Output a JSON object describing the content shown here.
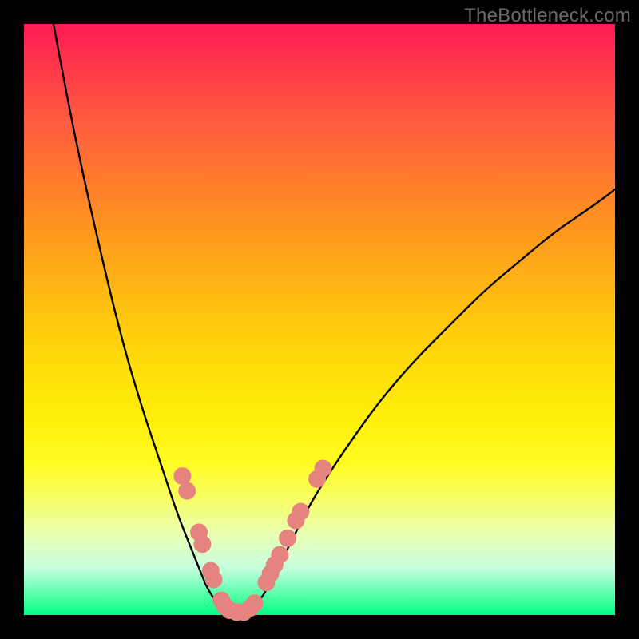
{
  "watermark": "TheBottleneck.com",
  "colors": {
    "frame": "#000000",
    "curve": "#000000",
    "marker_fill": "#e5847f",
    "marker_stroke": "#d46f6a"
  },
  "chart_data": {
    "type": "line",
    "title": "",
    "xlabel": "",
    "ylabel": "",
    "xlim": [
      0,
      100
    ],
    "ylim": [
      0,
      100
    ],
    "series": [
      {
        "name": "bottleneck-curve-left",
        "x": [
          5,
          8,
          11,
          14,
          17,
          20,
          22,
          24,
          26,
          28,
          30,
          31,
          33,
          34
        ],
        "y": [
          100,
          84,
          70,
          57,
          45,
          35,
          29,
          23,
          17,
          12,
          7,
          4.5,
          1.5,
          0.5
        ]
      },
      {
        "name": "bottleneck-curve-bottom",
        "x": [
          34,
          35,
          36,
          37,
          38
        ],
        "y": [
          0.5,
          0.2,
          0.2,
          0.2,
          0.5
        ]
      },
      {
        "name": "bottleneck-curve-right",
        "x": [
          38,
          40,
          42,
          44,
          46,
          48,
          51,
          55,
          60,
          66,
          72,
          78,
          84,
          90,
          96,
          100
        ],
        "y": [
          0.5,
          2.5,
          6,
          10,
          14,
          18,
          23,
          29,
          36,
          43,
          49,
          55,
          60,
          65,
          69,
          72
        ]
      }
    ],
    "markers": {
      "name": "highlight-dots",
      "points": [
        {
          "x": 26.8,
          "y": 23.5
        },
        {
          "x": 27.6,
          "y": 21.0
        },
        {
          "x": 29.6,
          "y": 14.0
        },
        {
          "x": 30.2,
          "y": 12.0
        },
        {
          "x": 31.6,
          "y": 7.5
        },
        {
          "x": 32.1,
          "y": 6.0
        },
        {
          "x": 33.4,
          "y": 2.5
        },
        {
          "x": 34.0,
          "y": 1.5
        },
        {
          "x": 34.8,
          "y": 0.8
        },
        {
          "x": 36.0,
          "y": 0.5
        },
        {
          "x": 37.2,
          "y": 0.5
        },
        {
          "x": 38.3,
          "y": 1.2
        },
        {
          "x": 39.0,
          "y": 2.0
        },
        {
          "x": 41.0,
          "y": 5.5
        },
        {
          "x": 41.7,
          "y": 7.0
        },
        {
          "x": 42.4,
          "y": 8.5
        },
        {
          "x": 43.3,
          "y": 10.2
        },
        {
          "x": 44.6,
          "y": 13.0
        },
        {
          "x": 46.0,
          "y": 16.0
        },
        {
          "x": 46.8,
          "y": 17.5
        },
        {
          "x": 49.6,
          "y": 23.0
        },
        {
          "x": 50.6,
          "y": 24.8
        }
      ]
    }
  }
}
